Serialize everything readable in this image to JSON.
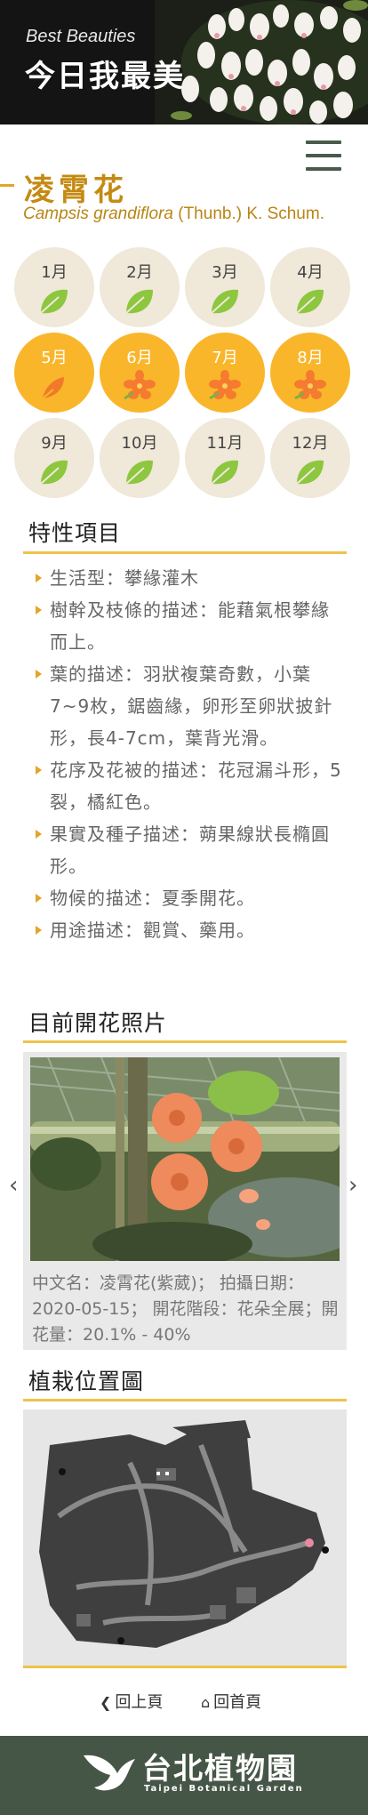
{
  "header": {
    "subtitle": "Best Beauties",
    "title": "今日我最美"
  },
  "plant": {
    "name_zh": "凌霄花",
    "scientific_name": "Campsis grandiflora",
    "authority": "(Thunb.) K. Schum."
  },
  "months": [
    {
      "label": "1月",
      "state": "leaf"
    },
    {
      "label": "2月",
      "state": "leaf"
    },
    {
      "label": "3月",
      "state": "leaf"
    },
    {
      "label": "4月",
      "state": "leaf"
    },
    {
      "label": "5月",
      "state": "bud"
    },
    {
      "label": "6月",
      "state": "flower"
    },
    {
      "label": "7月",
      "state": "flower"
    },
    {
      "label": "8月",
      "state": "flower"
    },
    {
      "label": "9月",
      "state": "leaf"
    },
    {
      "label": "10月",
      "state": "leaf"
    },
    {
      "label": "11月",
      "state": "leaf"
    },
    {
      "label": "12月",
      "state": "leaf"
    }
  ],
  "traits": {
    "title": "特性項目",
    "items": [
      "生活型：攀緣灌木",
      "樹幹及枝條的描述：能藉氣根攀緣而上。",
      "葉的描述：羽狀複葉奇數，小葉7~9枚，鋸齒緣，卵形至卵狀披針形，長4-7cm，葉背光滑。",
      "花序及花被的描述：花冠漏斗形，5裂，橘紅色。",
      "果實及種子描述：蒴果線狀長橢圓形。",
      "物候的描述：夏季開花。",
      "用途描述：觀賞、藥用。"
    ]
  },
  "photos": {
    "title": "目前開花照片",
    "caption": "中文名：凌霄花(紫葳)； 拍攝日期：2020-05-15； 開花階段：花朵全展；開花量：20.1% - 40%",
    "prev_icon": "chevron-left-icon",
    "next_icon": "chevron-right-icon"
  },
  "map": {
    "title": "植栽位置圖"
  },
  "nav": {
    "back": "回上頁",
    "home": "回首頁"
  },
  "footer": {
    "logo_zh": "台北植物園",
    "logo_en": "Taipei Botanical Garden"
  },
  "colors": {
    "accent": "#f0c24a",
    "title_gold": "#c48a12",
    "bloom": "#f9b62a",
    "month_bg": "#f0e8d8",
    "footer": "#465646",
    "leaf": "#8dc63f"
  }
}
